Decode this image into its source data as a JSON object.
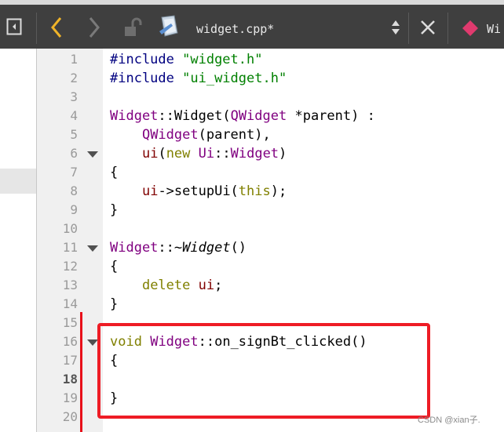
{
  "toolbar": {
    "file_name": "widget.cpp*",
    "next_tab_label": "Wi",
    "icons": {
      "toggle_sidebar": "sidebar-toggle-icon",
      "back": "chevron-left-icon",
      "forward": "chevron-right-icon",
      "lock": "unlocked-icon",
      "file": "cpp-file-icon",
      "updown": "updown-icon",
      "close": "close-icon",
      "qml": "diamond-icon"
    },
    "colors": {
      "back_arrow": "#f0b429",
      "qml_icon": "#e03a6e"
    }
  },
  "gutter": {
    "line_numbers": [
      "1",
      "2",
      "3",
      "4",
      "5",
      "6",
      "7",
      "8",
      "9",
      "10",
      "11",
      "12",
      "13",
      "14",
      "15",
      "16",
      "17",
      "18",
      "19",
      "20"
    ],
    "current_line": "18"
  },
  "code_lines": [
    [
      {
        "t": "#include ",
        "c": "preproc"
      },
      {
        "t": "\"widget.h\"",
        "c": "string"
      }
    ],
    [
      {
        "t": "#include ",
        "c": "preproc"
      },
      {
        "t": "\"ui_widget.h\"",
        "c": "string"
      }
    ],
    [],
    [
      {
        "t": "Widget",
        "c": "type"
      },
      {
        "t": "::",
        "c": "plain"
      },
      {
        "t": "Widget",
        "c": "plain"
      },
      {
        "t": "(",
        "c": "plain"
      },
      {
        "t": "QWidget",
        "c": "type"
      },
      {
        "t": " *parent) :",
        "c": "plain"
      }
    ],
    [
      {
        "t": "    ",
        "c": "plain"
      },
      {
        "t": "QWidget",
        "c": "type"
      },
      {
        "t": "(parent),",
        "c": "plain"
      }
    ],
    [
      {
        "t": "    ",
        "c": "plain"
      },
      {
        "t": "ui",
        "c": "member"
      },
      {
        "t": "(",
        "c": "plain"
      },
      {
        "t": "new",
        "c": "keyword"
      },
      {
        "t": " ",
        "c": "plain"
      },
      {
        "t": "Ui",
        "c": "type"
      },
      {
        "t": "::",
        "c": "plain"
      },
      {
        "t": "Widget",
        "c": "type"
      },
      {
        "t": ")",
        "c": "plain"
      }
    ],
    [
      {
        "t": "{",
        "c": "plain"
      }
    ],
    [
      {
        "t": "    ",
        "c": "plain"
      },
      {
        "t": "ui",
        "c": "member"
      },
      {
        "t": "->setupUi(",
        "c": "plain"
      },
      {
        "t": "this",
        "c": "keyword"
      },
      {
        "t": ");",
        "c": "plain"
      }
    ],
    [
      {
        "t": "}",
        "c": "plain"
      }
    ],
    [],
    [
      {
        "t": "Widget",
        "c": "type"
      },
      {
        "t": "::~",
        "c": "plain"
      },
      {
        "t": "Widget",
        "c": "italic"
      },
      {
        "t": "()",
        "c": "plain"
      }
    ],
    [
      {
        "t": "{",
        "c": "plain"
      }
    ],
    [
      {
        "t": "    ",
        "c": "plain"
      },
      {
        "t": "delete",
        "c": "keyword"
      },
      {
        "t": " ",
        "c": "plain"
      },
      {
        "t": "ui",
        "c": "member"
      },
      {
        "t": ";",
        "c": "plain"
      }
    ],
    [
      {
        "t": "}",
        "c": "plain"
      }
    ],
    [],
    [
      {
        "t": "void",
        "c": "keyword"
      },
      {
        "t": " ",
        "c": "plain"
      },
      {
        "t": "Widget",
        "c": "type"
      },
      {
        "t": "::on_signBt_clicked()",
        "c": "plain"
      }
    ],
    [
      {
        "t": "{",
        "c": "plain"
      }
    ],
    [],
    [
      {
        "t": "}",
        "c": "plain"
      }
    ],
    []
  ],
  "syntax_colors": {
    "preproc": "#000080",
    "string": "#008000",
    "type": "#800080",
    "keyword": "#808000",
    "member": "#800000",
    "plain": "#000000",
    "italic": "#000000"
  },
  "fold_lines": [
    6,
    11,
    16
  ],
  "highlight_color": "#ee1c25",
  "watermark": "CSDN @xian子."
}
